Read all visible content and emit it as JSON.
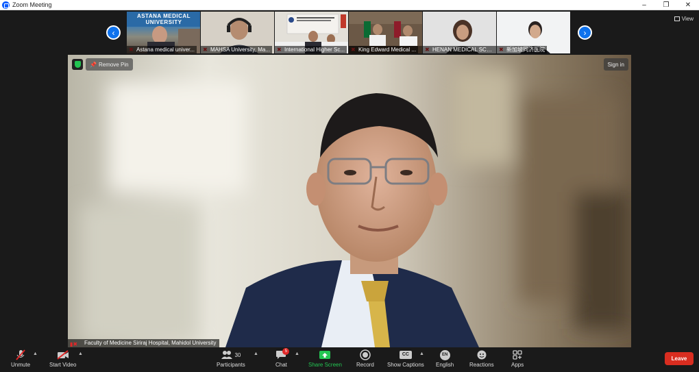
{
  "window": {
    "title": "Zoom Meeting",
    "controls": {
      "minimize": "–",
      "restore": "❐",
      "close": "✕"
    }
  },
  "view_button": {
    "label": "View",
    "icon": "grid-icon"
  },
  "gallery": {
    "prev_icon": "chevron-left-icon",
    "next_icon": "chevron-right-icon",
    "participants": [
      {
        "name": "Astana medical univer...",
        "muted": true,
        "tile_color": "#6a7d8c",
        "logo_text": "ASTANA MEDICAL UNIVERSITY"
      },
      {
        "name": "MAHSA University, Ma...",
        "muted": true,
        "tile_color": "#c9c2b6"
      },
      {
        "name": "International Higher Sc...",
        "muted": true,
        "tile_color": "#d7d4cc"
      },
      {
        "name": "King Edward Medical ...",
        "muted": true,
        "tile_color": "#6a5a4a"
      },
      {
        "name": "HENAN MEDICAL SCH...",
        "muted": true,
        "tile_color": "#d8d8d8"
      },
      {
        "name": "新加坡同济医院",
        "muted": true,
        "tile_color": "#eef0f2"
      }
    ]
  },
  "main_video": {
    "remove_pin_label": "Remove Pin",
    "sign_in_label": "Sign in",
    "speaker_name": "Faculty of Medicine Siriraj Hospital, Mahidol University",
    "security_color": "#23c552"
  },
  "toolbar": {
    "unmute": "Unmute",
    "start_video": "Start Video",
    "participants": "Participants",
    "participants_count": "30",
    "chat": "Chat",
    "chat_badge": "5",
    "share_screen": "Share Screen",
    "record": "Record",
    "show_captions": "Show Captions",
    "captions_icon_text": "CC",
    "english": "English",
    "english_icon_text": "EN",
    "reactions": "Reactions",
    "apps": "Apps",
    "leave": "Leave",
    "accent_green": "#23c552",
    "leave_color": "#d92d20"
  }
}
